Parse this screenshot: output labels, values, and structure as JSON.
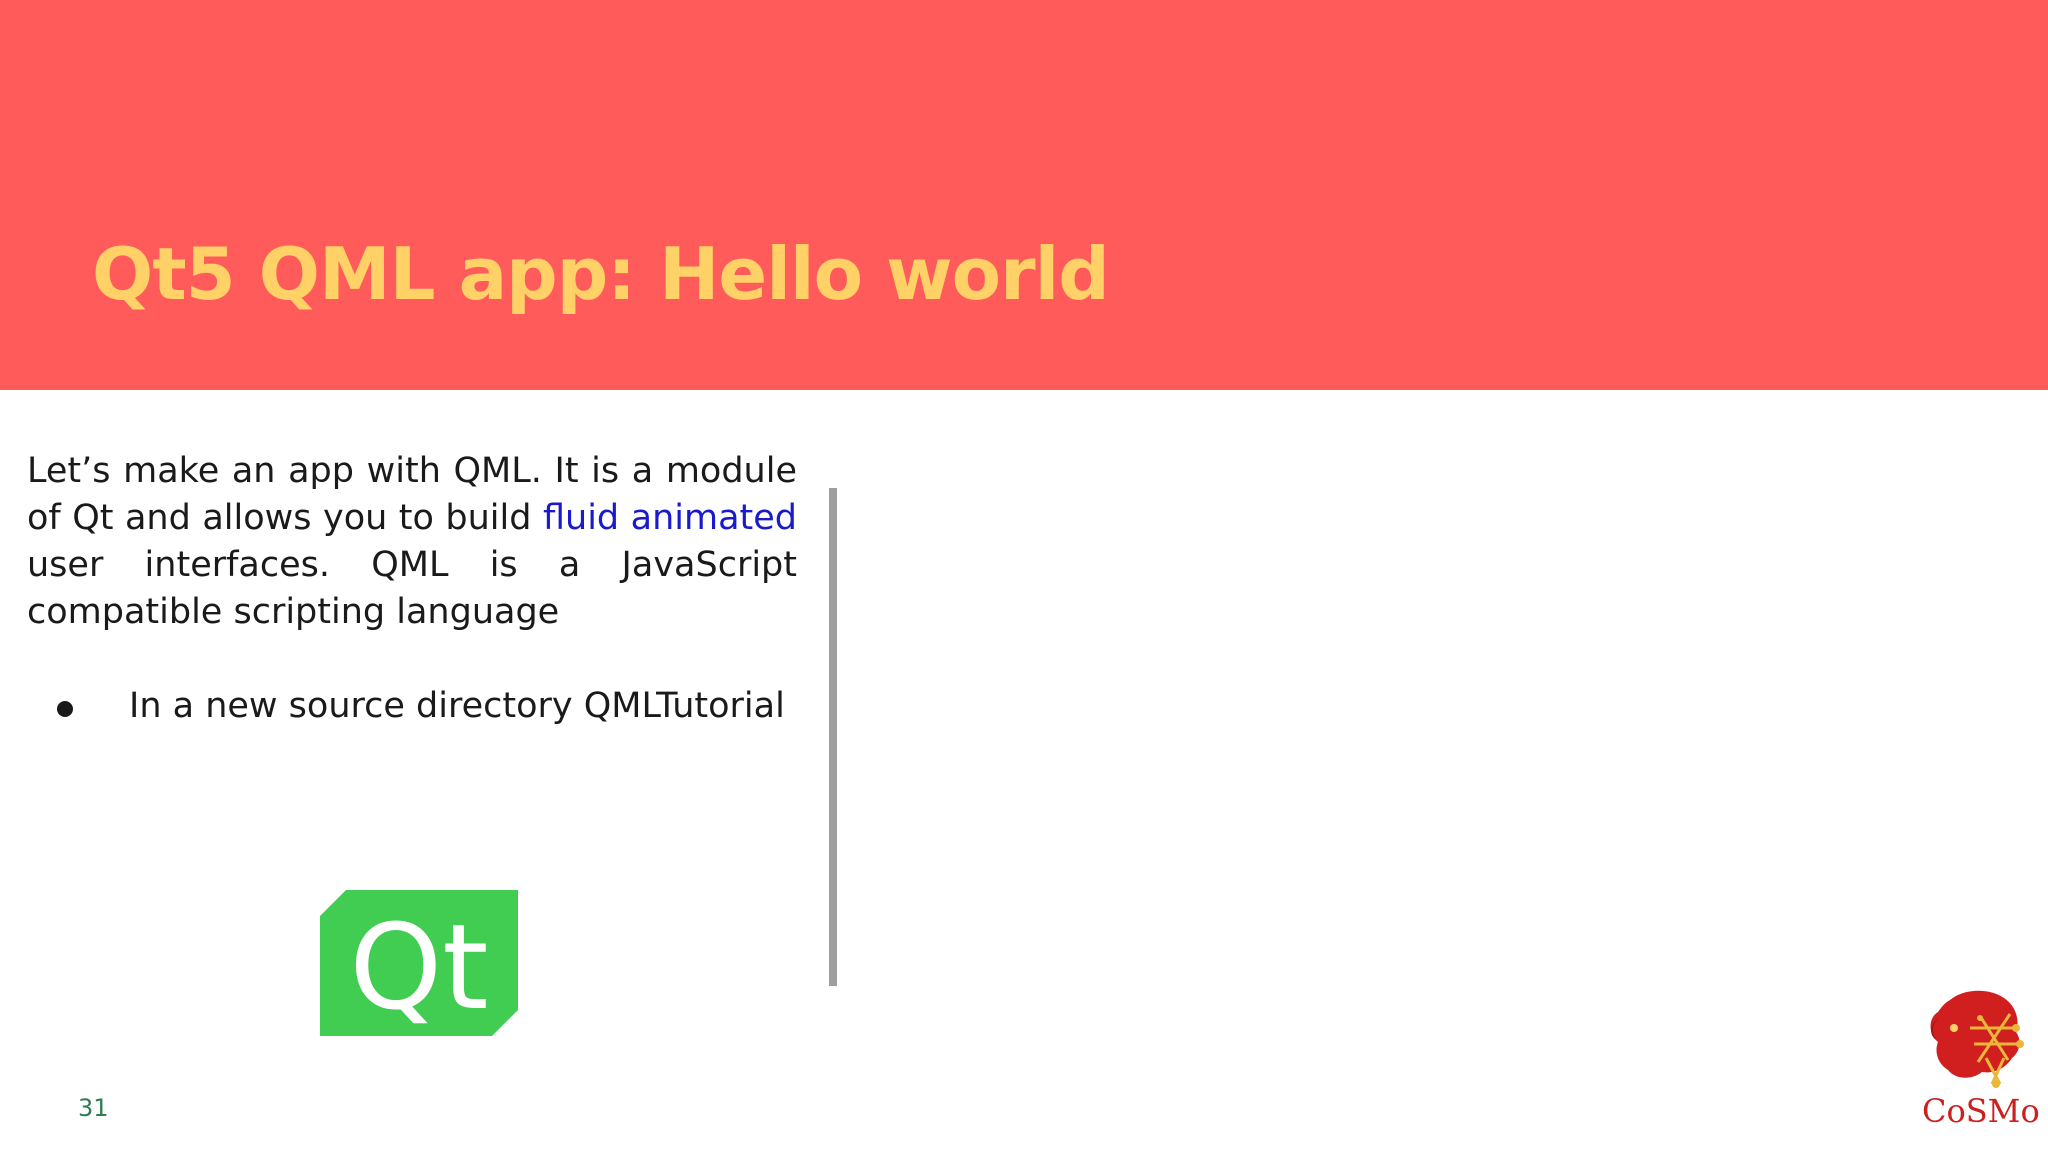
{
  "slide": {
    "title": "Qt5 QML app: Hello world",
    "paragraph": {
      "before_link": "Let’s make an app with QML. It is a module of Qt and allows you to build ",
      "link": "fluid animated",
      "after_link": " user interfaces. QML is a JavaScript compatible scripting language"
    },
    "bullets": [
      {
        "text": "In a new source directory QMLTutorial"
      }
    ],
    "page_number": "31"
  },
  "logos": {
    "qt": {
      "text": "Qt",
      "color": "#41cd52"
    },
    "cosmo": {
      "text": "CoSMo",
      "color": "#cc1f1f"
    }
  },
  "colors": {
    "header": "#ff5b5b",
    "title": "#ffd166",
    "link": "#1a1acc"
  }
}
